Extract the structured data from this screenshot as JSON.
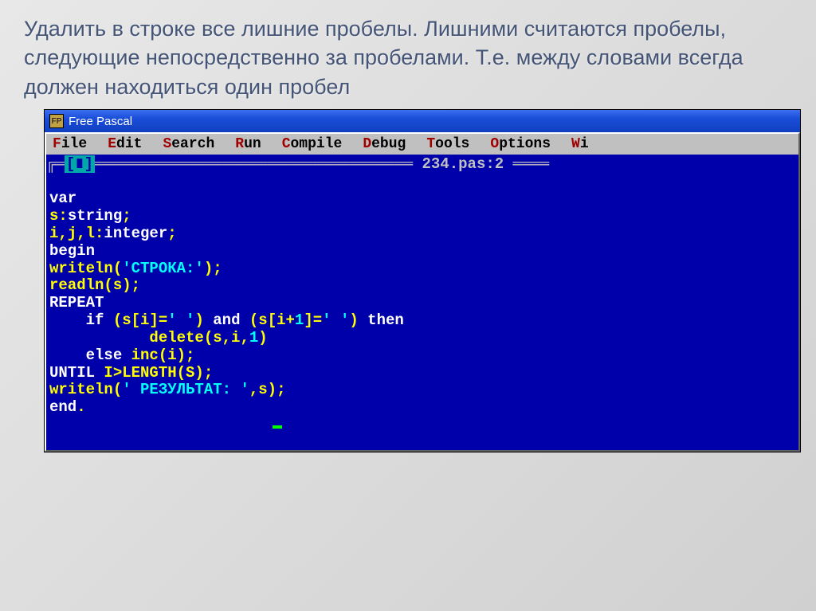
{
  "title": "Удалить в строке все лишние пробелы. Лишними считаются пробелы, следующие непосредственно за пробелами. Т.е. между словами всегда должен находиться один пробел",
  "window": {
    "title": "Free Pascal",
    "filename": "234.pas:2"
  },
  "menu": {
    "file": "File",
    "edit": "Edit",
    "search": "Search",
    "run": "Run",
    "compile": "Compile",
    "debug": "Debug",
    "tools": "Tools",
    "options": "Options",
    "window": "Wi"
  },
  "code": {
    "l1": "var",
    "l2a": "s:",
    "l2b": "string",
    "l2c": ";",
    "l3a": "i,j,l:",
    "l3b": "integer",
    "l3c": ";",
    "l4": "begin",
    "l5a": "writeln(",
    "l5b": "'СТРОКА:'",
    "l5c": ");",
    "l6": "readln(s);",
    "l7": "REPEAT",
    "l8a": "    if",
    "l8b": " (s[i]=",
    "l8c": "' '",
    "l8d": ") ",
    "l8e": "and",
    "l8f": " (s[i+",
    "l8g": "1",
    "l8h": "]=",
    "l8i": "' '",
    "l8j": ") ",
    "l8k": "then",
    "l9a": "           delete(s,i,",
    "l9b": "1",
    "l9c": ")",
    "l10a": "    else",
    "l10b": " inc(i);",
    "l11a": "UNTIL",
    "l11b": " I>LENGTH(S);",
    "l12a": "writeln(",
    "l12b": "' РЕЗУЛЬТАТ: '",
    "l12c": ",s);",
    "l13": "end",
    "l13b": "."
  }
}
